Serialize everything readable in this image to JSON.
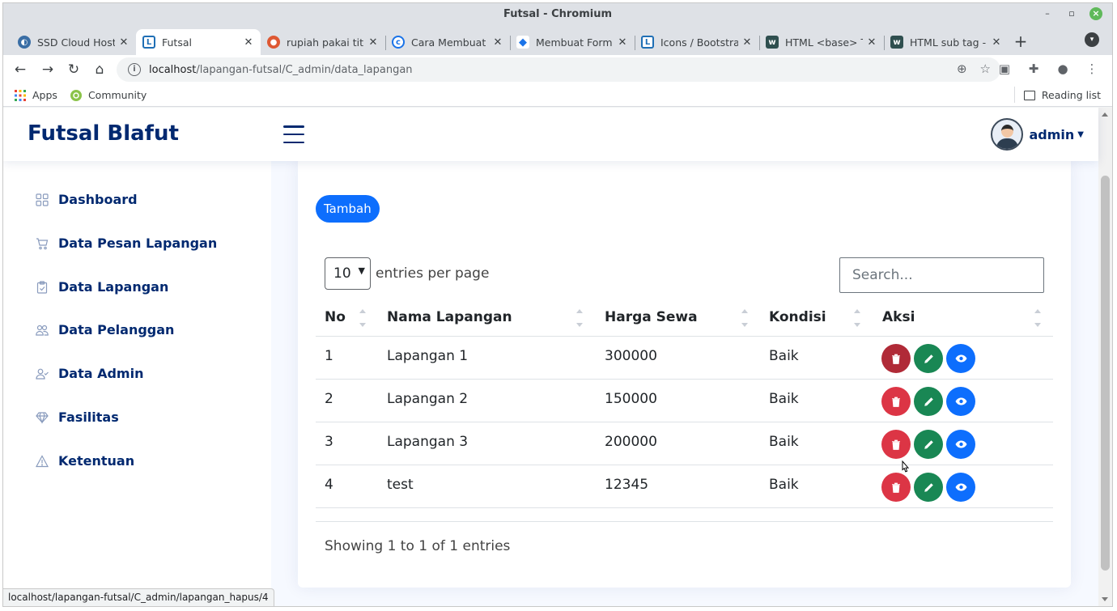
{
  "browser": {
    "window_title": "Futsal - Chromium",
    "tabs": [
      {
        "title": "SSD Cloud Host",
        "icon": "ssd-cloud-favicon",
        "active": false
      },
      {
        "title": "Futsal",
        "icon": "futsal-favicon",
        "active": true
      },
      {
        "title": "rupiah pakai titik",
        "icon": "duckduckgo-favicon",
        "active": false
      },
      {
        "title": "Cara Membuat",
        "icon": "codepolitan-favicon",
        "active": false
      },
      {
        "title": "Membuat Form",
        "icon": "code-favicon",
        "active": false
      },
      {
        "title": "Icons / Bootstrap",
        "icon": "bootstrap-favicon",
        "active": false
      },
      {
        "title": "HTML <base> T",
        "icon": "w3-favicon",
        "active": false
      },
      {
        "title": "HTML sub tag -",
        "icon": "w3-favicon",
        "active": false
      }
    ],
    "url_host": "localhost",
    "url_path": "/lapangan-futsal/C_admin/data_lapangan",
    "bookmarks": [
      {
        "label": "Apps",
        "icon": "apps-grid-icon"
      },
      {
        "label": "Community",
        "icon": "ubuntu-icon"
      }
    ],
    "reading_list": "Reading list",
    "status_url": "localhost/lapangan-futsal/C_admin/lapangan_hapus/4"
  },
  "header": {
    "logo": "Futsal Blafut",
    "user": "admin"
  },
  "sidebar": {
    "items": [
      {
        "label": "Dashboard",
        "icon": "grid-icon"
      },
      {
        "label": "Data Pesan Lapangan",
        "icon": "cart-icon"
      },
      {
        "label": "Data Lapangan",
        "icon": "clipboard-check-icon"
      },
      {
        "label": "Data Pelanggan",
        "icon": "people-icon"
      },
      {
        "label": "Data Admin",
        "icon": "person-check-icon"
      },
      {
        "label": "Fasilitas",
        "icon": "gem-icon"
      },
      {
        "label": "Ketentuan",
        "icon": "warning-triangle-icon"
      }
    ]
  },
  "main": {
    "add_button": "Tambah",
    "per_page_value": "10",
    "per_page_label": "entries per page",
    "search_placeholder": "Search...",
    "columns": [
      "No",
      "Nama Lapangan",
      "Harga Sewa",
      "Kondisi",
      "Aksi"
    ],
    "rows": [
      {
        "no": "1",
        "nama": "Lapangan 1",
        "harga": "300000",
        "kondisi": "Baik"
      },
      {
        "no": "2",
        "nama": "Lapangan 2",
        "harga": "150000",
        "kondisi": "Baik"
      },
      {
        "no": "3",
        "nama": "Lapangan 3",
        "harga": "200000",
        "kondisi": "Baik"
      },
      {
        "no": "4",
        "nama": "test",
        "harga": "12345",
        "kondisi": "Baik"
      }
    ],
    "info": "Showing 1 to 1 of 1 entries"
  },
  "colors": {
    "brand": "#012970",
    "primary": "#0d6efd",
    "danger": "#dc3545",
    "success": "#198754"
  }
}
